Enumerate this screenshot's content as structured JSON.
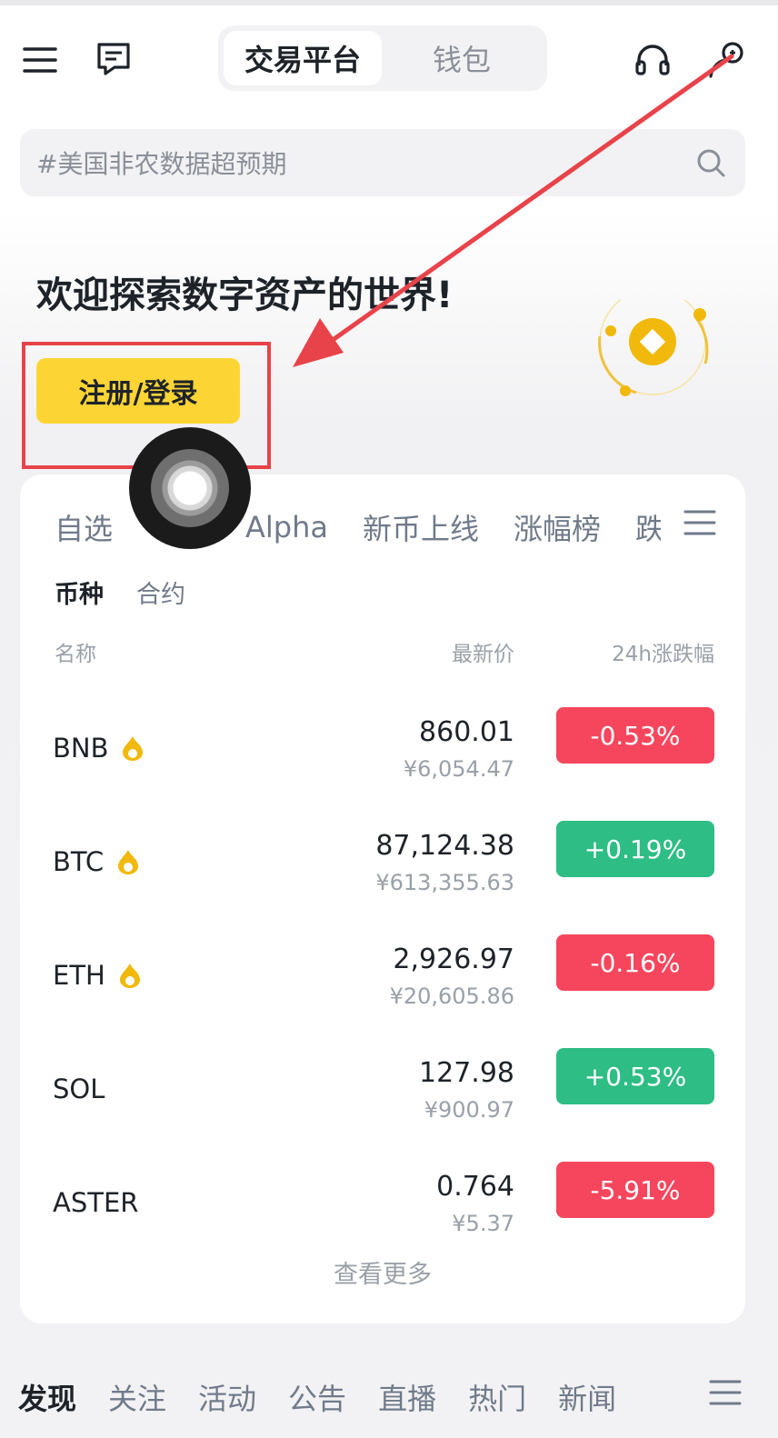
{
  "header": {
    "tabs": [
      {
        "label": "交易平台",
        "active": true
      },
      {
        "label": "钱包",
        "active": false
      }
    ],
    "icons": [
      "menu-icon",
      "message-icon",
      "headset-icon",
      "user-icon"
    ]
  },
  "search": {
    "placeholder": "#美国非农数据超预期"
  },
  "hero": {
    "welcome": "欢迎探索数字资产的世界!",
    "cta_label": "注册/登录"
  },
  "market": {
    "tabs": [
      "自选",
      "Alpha",
      "新币上线",
      "涨幅榜",
      "跌"
    ],
    "subtabs": [
      {
        "label": "币种",
        "active": true
      },
      {
        "label": "合约",
        "active": false
      }
    ],
    "columns": {
      "name": "名称",
      "price": "最新价",
      "change": "24h涨跌幅"
    },
    "rows": [
      {
        "symbol": "BNB",
        "flame": true,
        "price": "860.01",
        "cny": "¥6,054.47",
        "change": "-0.53%",
        "direction": "down"
      },
      {
        "symbol": "BTC",
        "flame": true,
        "price": "87,124.38",
        "cny": "¥613,355.63",
        "change": "+0.19%",
        "direction": "up"
      },
      {
        "symbol": "ETH",
        "flame": true,
        "price": "2,926.97",
        "cny": "¥20,605.86",
        "change": "-0.16%",
        "direction": "down"
      },
      {
        "symbol": "SOL",
        "flame": false,
        "price": "127.98",
        "cny": "¥900.97",
        "change": "+0.53%",
        "direction": "up"
      },
      {
        "symbol": "ASTER",
        "flame": false,
        "price": "0.764",
        "cny": "¥5.37",
        "change": "-5.91%",
        "direction": "down"
      }
    ],
    "view_more": "查看更多"
  },
  "bottom_tabs": [
    {
      "label": "发现",
      "active": true
    },
    {
      "label": "关注",
      "active": false
    },
    {
      "label": "活动",
      "active": false
    },
    {
      "label": "公告",
      "active": false
    },
    {
      "label": "直播",
      "active": false
    },
    {
      "label": "热门",
      "active": false
    },
    {
      "label": "新闻",
      "active": false
    }
  ],
  "colors": {
    "brand_yellow": "#fcd535",
    "up_green": "#2ebd85",
    "down_red": "#f6465d",
    "annotation_red": "#e8434a"
  }
}
